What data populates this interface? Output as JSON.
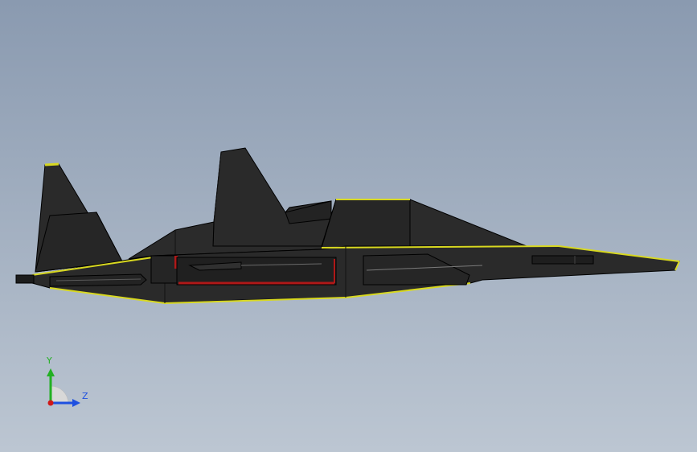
{
  "viewport": {
    "background_top": "#8a9ab0",
    "background_bottom": "#bcc6d2",
    "model_fill": "#2a2a2a",
    "model_dark": "#1e1e1e",
    "model_edge": "#000000",
    "highlight_edge": "#d8d820",
    "detail_red": "#b01818",
    "detail_gray": "#7a7a7a"
  },
  "triad": {
    "y_label": "Y",
    "z_label": "Z",
    "y_color": "#22b022",
    "z_color": "#1e50e0",
    "origin_color": "#d01818"
  }
}
